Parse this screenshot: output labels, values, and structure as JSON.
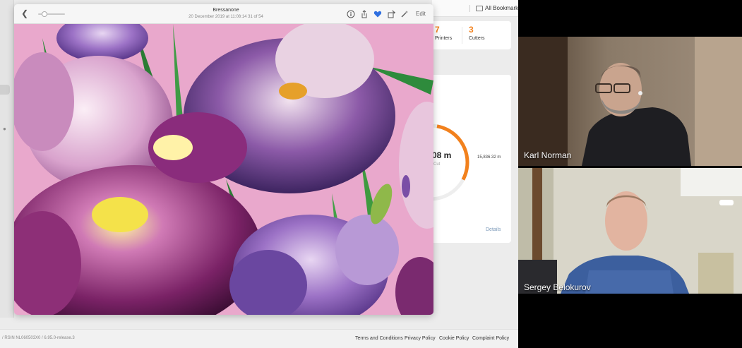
{
  "viewer": {
    "title": "Bressanone",
    "subtitle": "20 December 2019 at 11:08:14     31 of 54",
    "edit_label": "Edit",
    "toolbar_icons": [
      "back-chevron-icon",
      "zoom-slider",
      "info-icon",
      "share-icon",
      "heart-icon",
      "rotate-icon",
      "magic-wand-icon"
    ]
  },
  "bookmarks_bar": {
    "label": "All Bookmarks"
  },
  "dashboard": {
    "stats": [
      {
        "value": "7",
        "label": "Printers"
      },
      {
        "value": "3",
        "label": "Cutters"
      }
    ],
    "gauge": {
      "value": "08 m",
      "sublabel": "Cut",
      "total": "15,836.32 m",
      "progress_fraction": 0.3
    },
    "details_label": "Details",
    "accent_color": "#f2811d"
  },
  "footer": {
    "version": "/ RSIN NL060503X0 / 6.95.0-release.3",
    "links": [
      "Terms and Conditions",
      "Privacy Policy",
      "Cookie Policy",
      "Complaint Policy"
    ]
  },
  "participants": [
    {
      "name": "Karl Norman"
    },
    {
      "name": "Sergey Belokurov"
    }
  ]
}
